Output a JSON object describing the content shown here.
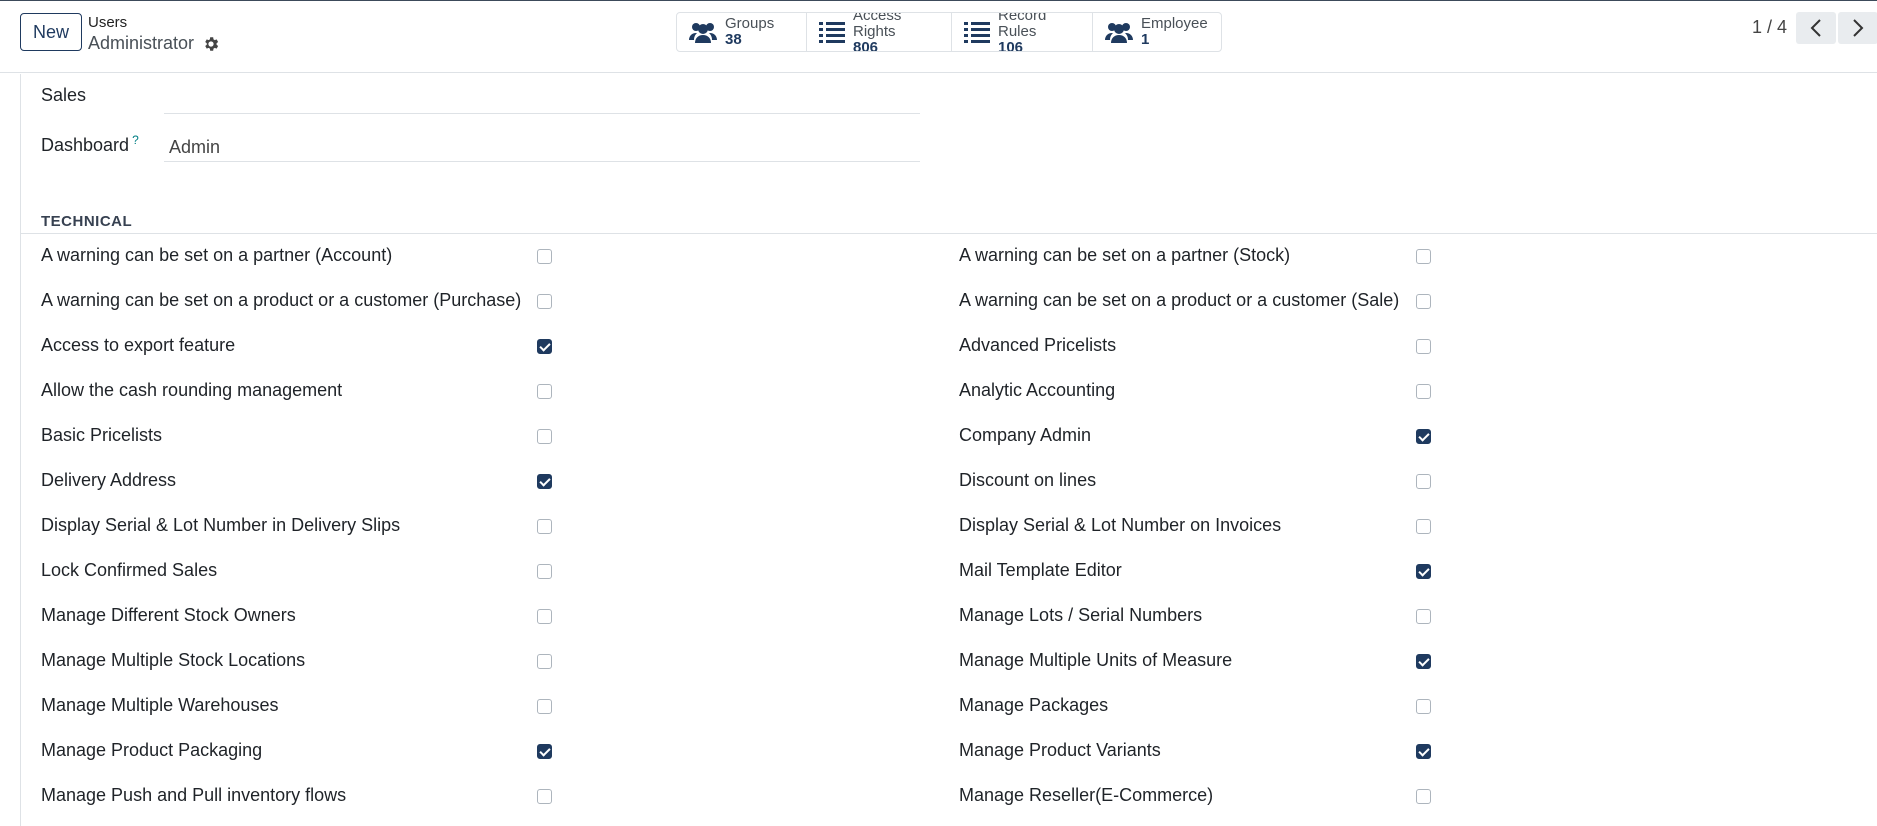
{
  "control_panel": {
    "new_label": "New",
    "breadcrumb_parent": "Users",
    "breadcrumb_current": "Administrator",
    "smart_buttons": [
      {
        "label": "Groups",
        "value": "38",
        "icon": "users-icon"
      },
      {
        "label": "Access Rights",
        "value": "806",
        "icon": "list-icon"
      },
      {
        "label": "Record Rules",
        "value": "106",
        "icon": "list-icon"
      },
      {
        "label": "Employee",
        "value": "1",
        "icon": "users-icon"
      }
    ],
    "pager": "1 / 4"
  },
  "fields": {
    "sales_label": "Sales",
    "sales_value": "",
    "dashboard_label": "Dashboard",
    "dashboard_help": "?",
    "dashboard_value": "Admin"
  },
  "technical": {
    "title": "TECHNICAL",
    "left": [
      {
        "label": "A warning can be set on a partner (Account)",
        "checked": false
      },
      {
        "label": "A warning can be set on a product or a customer (Purchase)",
        "checked": false
      },
      {
        "label": "Access to export feature",
        "checked": true
      },
      {
        "label": "Allow the cash rounding management",
        "checked": false
      },
      {
        "label": "Basic Pricelists",
        "checked": false
      },
      {
        "label": "Delivery Address",
        "checked": true
      },
      {
        "label": "Display Serial & Lot Number in Delivery Slips",
        "checked": false
      },
      {
        "label": "Lock Confirmed Sales",
        "checked": false
      },
      {
        "label": "Manage Different Stock Owners",
        "checked": false
      },
      {
        "label": "Manage Multiple Stock Locations",
        "checked": false
      },
      {
        "label": "Manage Multiple Warehouses",
        "checked": false
      },
      {
        "label": "Manage Product Packaging",
        "checked": true
      },
      {
        "label": "Manage Push and Pull inventory flows",
        "checked": false
      }
    ],
    "right": [
      {
        "label": "A warning can be set on a partner (Stock)",
        "checked": false
      },
      {
        "label": "A warning can be set on a product or a customer (Sale)",
        "checked": false
      },
      {
        "label": "Advanced Pricelists",
        "checked": false
      },
      {
        "label": "Analytic Accounting",
        "checked": false
      },
      {
        "label": "Company Admin",
        "checked": true
      },
      {
        "label": "Discount on lines",
        "checked": false
      },
      {
        "label": "Display Serial & Lot Number on Invoices",
        "checked": false
      },
      {
        "label": "Mail Template Editor",
        "checked": true
      },
      {
        "label": "Manage Lots / Serial Numbers",
        "checked": false
      },
      {
        "label": "Manage Multiple Units of Measure",
        "checked": true
      },
      {
        "label": "Manage Packages",
        "checked": false
      },
      {
        "label": "Manage Product Variants",
        "checked": true
      },
      {
        "label": "Manage Reseller(E-Commerce)",
        "checked": false
      }
    ]
  }
}
